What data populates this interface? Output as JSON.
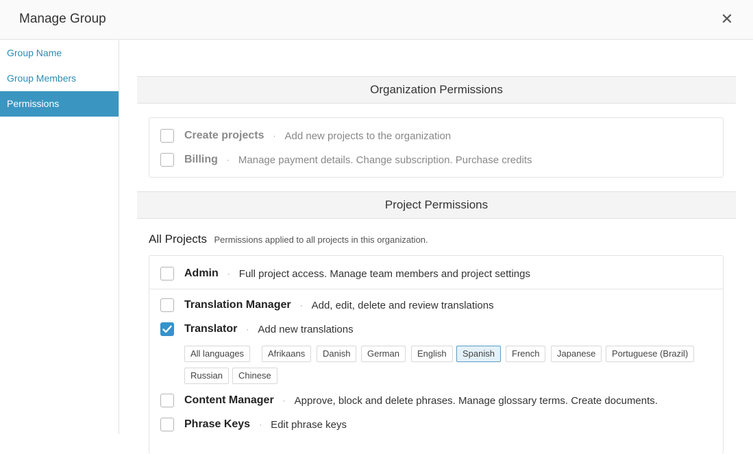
{
  "header": {
    "title": "Manage Group",
    "close_glyph": "✕"
  },
  "sidebar": {
    "items": [
      {
        "label": "Group Name"
      },
      {
        "label": "Group Members"
      },
      {
        "label": "Permissions"
      }
    ],
    "active_index": 2
  },
  "org": {
    "heading": "Organization Permissions",
    "items": [
      {
        "name": "Create projects",
        "desc": "Add new projects to the organization",
        "checked": false
      },
      {
        "name": "Billing",
        "desc": "Manage payment details. Change subscription. Purchase credits",
        "checked": false
      }
    ]
  },
  "project": {
    "heading": "Project Permissions",
    "all_projects_title": "All Projects",
    "all_projects_desc": "Permissions applied to all projects in this organization.",
    "items": [
      {
        "name": "Admin",
        "desc": "Full project access. Manage team members and project settings",
        "checked": false
      },
      {
        "name": "Translation Manager",
        "desc": "Add, edit, delete and review translations",
        "checked": false
      },
      {
        "name": "Translator",
        "desc": "Add new translations",
        "checked": true
      },
      {
        "name": "Content Manager",
        "desc": "Approve, block and delete phrases. Manage glossary terms. Create documents.",
        "checked": false
      },
      {
        "name": "Phrase Keys",
        "desc": "Edit phrase keys",
        "checked": false
      }
    ],
    "separator": "·"
  },
  "languages": {
    "all_label": "All languages",
    "chips": [
      {
        "label": "Afrikaans",
        "selected": false
      },
      {
        "label": "Danish",
        "selected": false
      },
      {
        "label": "German",
        "selected": false
      },
      {
        "label": "English",
        "selected": false
      },
      {
        "label": "Spanish",
        "selected": true
      },
      {
        "label": "French",
        "selected": false
      },
      {
        "label": "Japanese",
        "selected": false
      },
      {
        "label": "Portuguese (Brazil)",
        "selected": false
      },
      {
        "label": "Russian",
        "selected": false
      },
      {
        "label": "Chinese",
        "selected": false
      }
    ]
  },
  "colors": {
    "accent": "#3a96c0",
    "link": "#2b8cb3",
    "checkbox_checked": "#3493cb"
  },
  "icons": {
    "close": "close-icon",
    "check": "check-icon"
  }
}
